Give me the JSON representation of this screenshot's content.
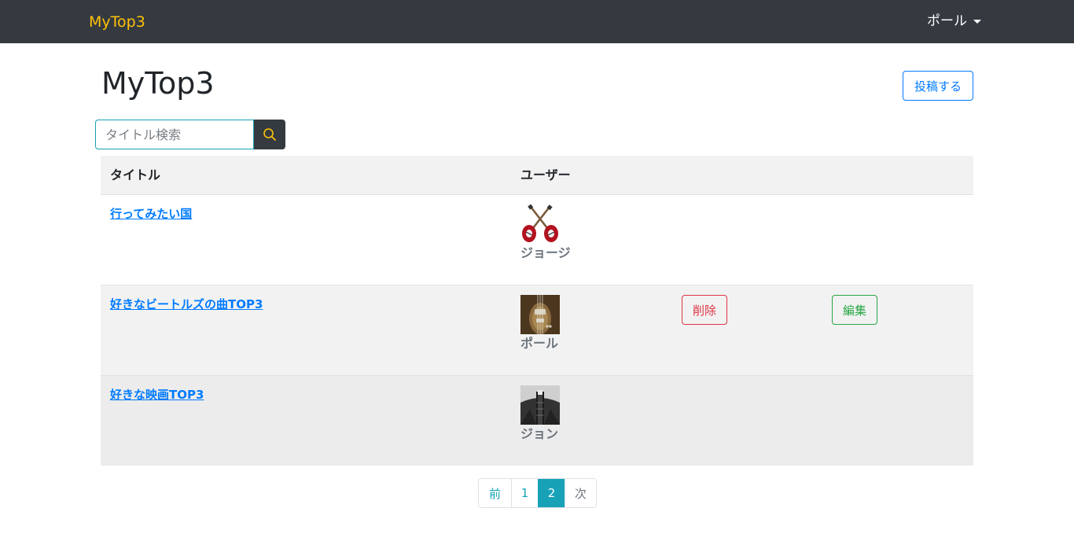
{
  "navbar": {
    "brand": "MyTop3",
    "user_menu": "ポール"
  },
  "header": {
    "title": "MyTop3",
    "post_button": "投稿する"
  },
  "search": {
    "placeholder": "タイトル検索",
    "value": "",
    "button_icon": "search-icon"
  },
  "table": {
    "headers": {
      "title": "タイトル",
      "user": "ユーザー"
    },
    "rows": [
      {
        "title": "行ってみたい国",
        "user": "ジョージ",
        "avatar_icon": "crossed-guitars-icon"
      },
      {
        "title": "好きなビートルズの曲TOP3",
        "user": "ポール",
        "avatar_icon": "violin-bass-photo",
        "delete_label": "削除",
        "edit_label": "編集"
      },
      {
        "title": "好きな映画TOP3",
        "user": "ジョン",
        "avatar_icon": "guitar-neck-photo"
      }
    ]
  },
  "pagination": {
    "prev": "前",
    "pages": [
      "1",
      "2"
    ],
    "active_page": "2",
    "next": "次"
  },
  "colors": {
    "navbar_bg": "#343a40",
    "brand": "#ffc107",
    "primary": "#007bff",
    "info": "#17a2b8",
    "danger": "#dc3545",
    "success": "#28a745"
  }
}
